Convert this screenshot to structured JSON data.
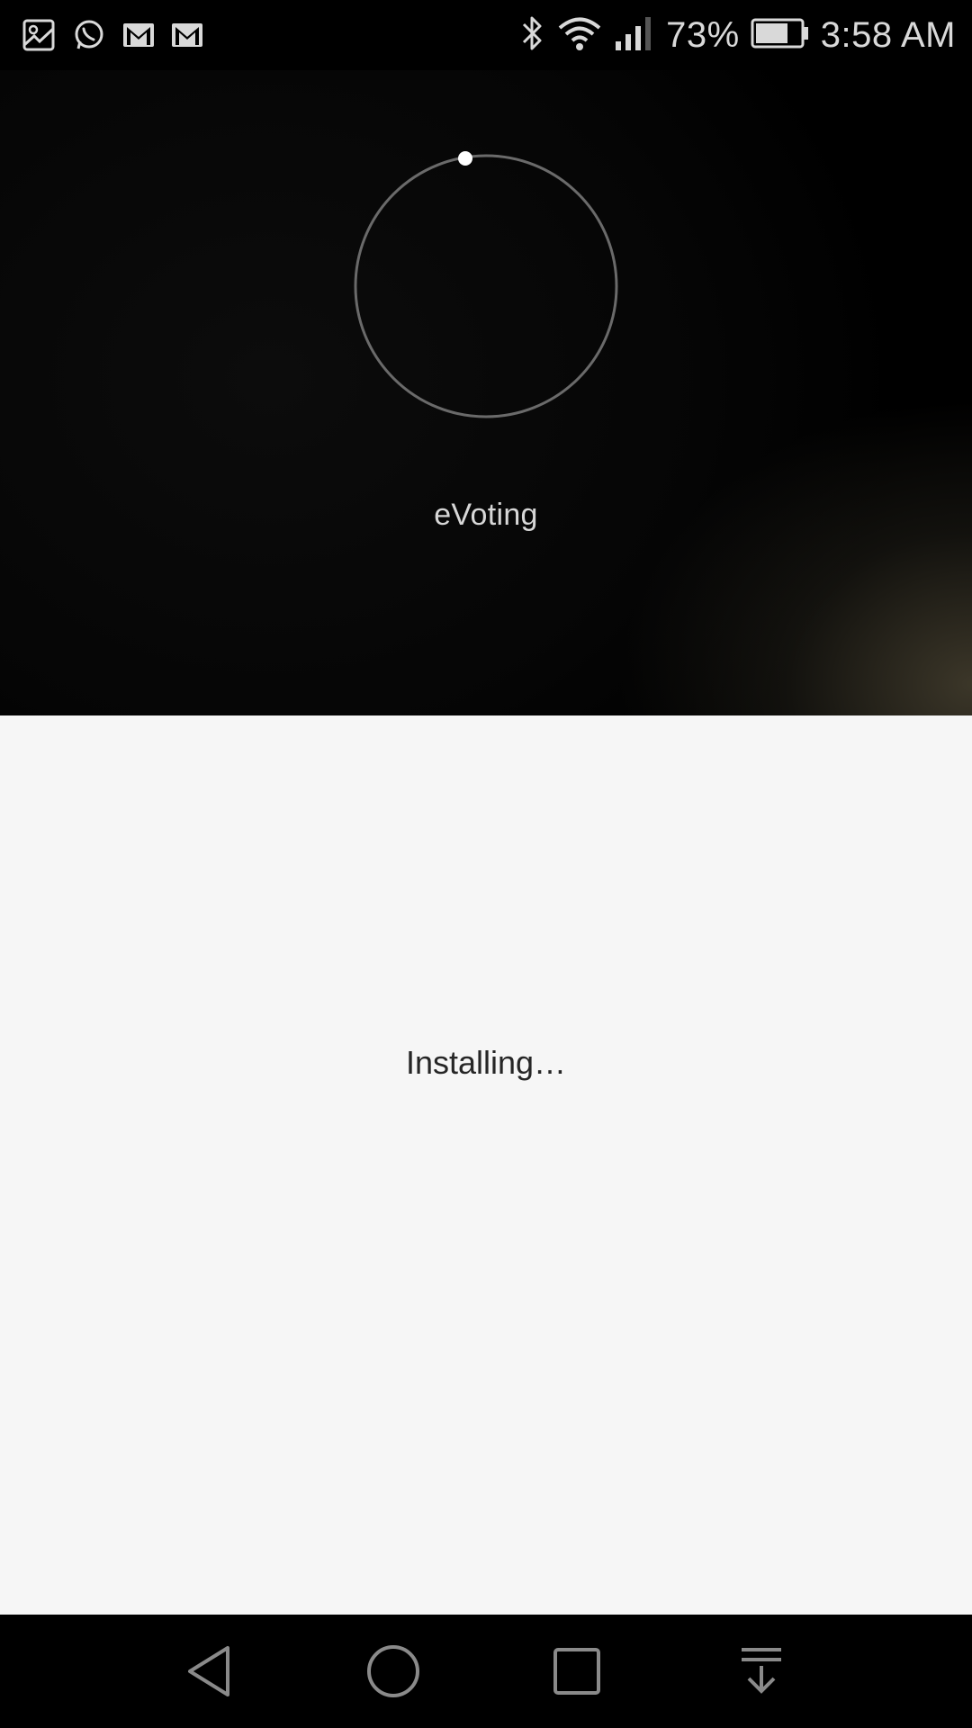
{
  "status_bar": {
    "notification_icons": [
      "image-icon",
      "whatsapp-icon",
      "gmail-icon",
      "gmail-icon"
    ],
    "system_icons": [
      "bluetooth-icon",
      "wifi-icon",
      "signal-icon",
      "battery-icon"
    ],
    "battery_percent": "73%",
    "battery_level": 0.73,
    "time": "3:58 AM"
  },
  "installer": {
    "app_name": "eVoting",
    "status_text": "Installing…",
    "spinner_icon": "loading-ring-icon"
  },
  "nav_bar": {
    "buttons": [
      "back-icon",
      "home-icon",
      "recents-icon",
      "hide-nav-icon"
    ]
  },
  "colors": {
    "top_panel_bg": "#050505",
    "content_bg": "#f6f6f6",
    "ring_stroke": "#6a6a6a",
    "ring_dot": "#ffffff",
    "nav_icon": "#8a8a8a"
  }
}
